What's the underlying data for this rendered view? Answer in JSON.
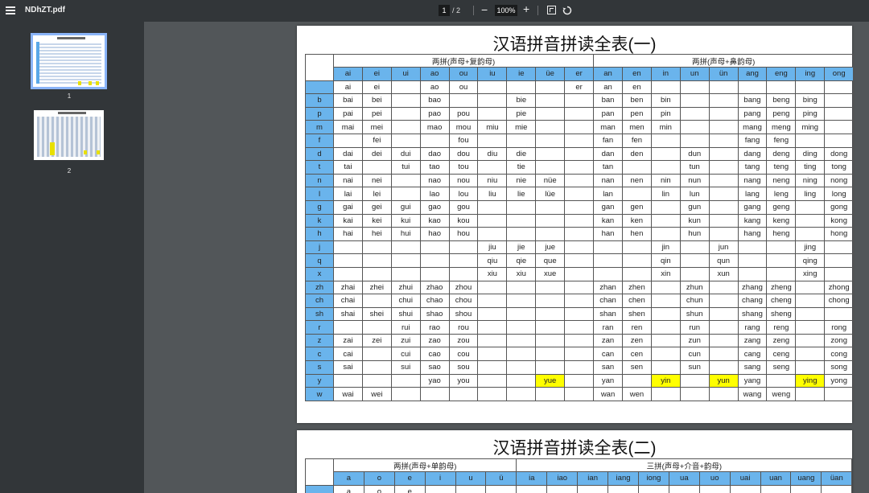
{
  "toolbar": {
    "title": "NDhZT.pdf",
    "page_current": "1",
    "page_sep": "/  2",
    "zoom_out": "−",
    "zoom_value": "100%",
    "zoom_in": "+",
    "icons": [
      "menu-icon",
      "fit-page-icon",
      "rotate-icon"
    ]
  },
  "sidebar": {
    "thumbs": [
      {
        "label": "1"
      },
      {
        "label": "2"
      }
    ]
  },
  "page1": {
    "title": "汉语拼音拼读全表(一)",
    "group_left": "两拼(声母+复韵母)",
    "group_right": "两拼(声母+鼻韵母)",
    "finals": [
      "ai",
      "ei",
      "ui",
      "ao",
      "ou",
      "iu",
      "ie",
      "üe",
      "er",
      "an",
      "en",
      "in",
      "un",
      "ün",
      "ang",
      "eng",
      "ing",
      "ong"
    ],
    "rows": [
      {
        "init": "",
        "cells": [
          "ai",
          "ei",
          "",
          "ao",
          "ou",
          "",
          "",
          "",
          "er",
          "an",
          "en",
          "",
          "",
          "",
          "",
          "",
          "",
          ""
        ]
      },
      {
        "init": "b",
        "cells": [
          "bai",
          "bei",
          "",
          "bao",
          "",
          "",
          "bie",
          "",
          "",
          "ban",
          "ben",
          "bin",
          "",
          "",
          "bang",
          "beng",
          "bing",
          ""
        ]
      },
      {
        "init": "p",
        "cells": [
          "pai",
          "pei",
          "",
          "pao",
          "pou",
          "",
          "pie",
          "",
          "",
          "pan",
          "pen",
          "pin",
          "",
          "",
          "pang",
          "peng",
          "ping",
          ""
        ]
      },
      {
        "init": "m",
        "cells": [
          "mai",
          "mei",
          "",
          "mao",
          "mou",
          "miu",
          "mie",
          "",
          "",
          "man",
          "men",
          "min",
          "",
          "",
          "mang",
          "meng",
          "ming",
          ""
        ]
      },
      {
        "init": "f",
        "cells": [
          "",
          "fei",
          "",
          "",
          "fou",
          "",
          "",
          "",
          "",
          "fan",
          "fen",
          "",
          "",
          "",
          "fang",
          "feng",
          "",
          ""
        ]
      },
      {
        "init": "d",
        "cells": [
          "dai",
          "dei",
          "dui",
          "dao",
          "dou",
          "diu",
          "die",
          "",
          "",
          "dan",
          "den",
          "",
          "dun",
          "",
          "dang",
          "deng",
          "ding",
          "dong"
        ]
      },
      {
        "init": "t",
        "cells": [
          "tai",
          "",
          "tui",
          "tao",
          "tou",
          "",
          "tie",
          "",
          "",
          "tan",
          "",
          "",
          "tun",
          "",
          "tang",
          "teng",
          "ting",
          "tong"
        ]
      },
      {
        "init": "n",
        "cells": [
          "nai",
          "nei",
          "",
          "nao",
          "nou",
          "niu",
          "nie",
          "nüe",
          "",
          "nan",
          "nen",
          "nin",
          "nun",
          "",
          "nang",
          "neng",
          "ning",
          "nong"
        ]
      },
      {
        "init": "l",
        "cells": [
          "lai",
          "lei",
          "",
          "lao",
          "lou",
          "liu",
          "lie",
          "lüe",
          "",
          "lan",
          "",
          "lin",
          "lun",
          "",
          "lang",
          "leng",
          "ling",
          "long"
        ]
      },
      {
        "init": "g",
        "cells": [
          "gai",
          "gei",
          "gui",
          "gao",
          "gou",
          "",
          "",
          "",
          "",
          "gan",
          "gen",
          "",
          "gun",
          "",
          "gang",
          "geng",
          "",
          "gong"
        ]
      },
      {
        "init": "k",
        "cells": [
          "kai",
          "kei",
          "kui",
          "kao",
          "kou",
          "",
          "",
          "",
          "",
          "kan",
          "ken",
          "",
          "kun",
          "",
          "kang",
          "keng",
          "",
          "kong"
        ]
      },
      {
        "init": "h",
        "cells": [
          "hai",
          "hei",
          "hui",
          "hao",
          "hou",
          "",
          "",
          "",
          "",
          "han",
          "hen",
          "",
          "hun",
          "",
          "hang",
          "heng",
          "",
          "hong"
        ]
      },
      {
        "init": "j",
        "cells": [
          "",
          "",
          "",
          "",
          "",
          "jiu",
          "jie",
          "jue",
          "",
          "",
          "",
          "jin",
          "",
          "jun",
          "",
          "",
          "jing",
          ""
        ]
      },
      {
        "init": "q",
        "cells": [
          "",
          "",
          "",
          "",
          "",
          "qiu",
          "qie",
          "que",
          "",
          "",
          "",
          "qin",
          "",
          "qun",
          "",
          "",
          "qing",
          ""
        ]
      },
      {
        "init": "x",
        "cells": [
          "",
          "",
          "",
          "",
          "",
          "xiu",
          "xiu",
          "xue",
          "",
          "",
          "",
          "xin",
          "",
          "xun",
          "",
          "",
          "xing",
          ""
        ]
      },
      {
        "init": "zh",
        "cells": [
          "zhai",
          "zhei",
          "zhui",
          "zhao",
          "zhou",
          "",
          "",
          "",
          "",
          "zhan",
          "zhen",
          "",
          "zhun",
          "",
          "zhang",
          "zheng",
          "",
          "zhong"
        ]
      },
      {
        "init": "ch",
        "cells": [
          "chai",
          "",
          "chui",
          "chao",
          "chou",
          "",
          "",
          "",
          "",
          "chan",
          "chen",
          "",
          "chun",
          "",
          "chang",
          "cheng",
          "",
          "chong"
        ]
      },
      {
        "init": "sh",
        "cells": [
          "shai",
          "shei",
          "shui",
          "shao",
          "shou",
          "",
          "",
          "",
          "",
          "shan",
          "shen",
          "",
          "shun",
          "",
          "shang",
          "sheng",
          "",
          ""
        ]
      },
      {
        "init": "r",
        "cells": [
          "",
          "",
          "rui",
          "rao",
          "rou",
          "",
          "",
          "",
          "",
          "ran",
          "ren",
          "",
          "run",
          "",
          "rang",
          "reng",
          "",
          "rong"
        ]
      },
      {
        "init": "z",
        "cells": [
          "zai",
          "zei",
          "zui",
          "zao",
          "zou",
          "",
          "",
          "",
          "",
          "zan",
          "zen",
          "",
          "zun",
          "",
          "zang",
          "zeng",
          "",
          "zong"
        ]
      },
      {
        "init": "c",
        "cells": [
          "cai",
          "",
          "cui",
          "cao",
          "cou",
          "",
          "",
          "",
          "",
          "can",
          "cen",
          "",
          "cun",
          "",
          "cang",
          "ceng",
          "",
          "cong"
        ]
      },
      {
        "init": "s",
        "cells": [
          "sai",
          "",
          "sui",
          "sao",
          "sou",
          "",
          "",
          "",
          "",
          "san",
          "sen",
          "",
          "sun",
          "",
          "sang",
          "seng",
          "",
          "song"
        ]
      },
      {
        "init": "y",
        "cells": [
          "",
          "",
          "",
          "yao",
          "you",
          "",
          "",
          "yue",
          "",
          "yan",
          "",
          "yin",
          "",
          "yun",
          "yang",
          "",
          "ying",
          "yong"
        ]
      },
      {
        "init": "w",
        "cells": [
          "wai",
          "wei",
          "",
          "",
          "",
          "",
          "",
          "",
          "",
          "wan",
          "wen",
          "",
          "",
          "",
          "wang",
          "weng",
          "",
          ""
        ]
      }
    ],
    "highlights": [
      [
        22,
        7
      ],
      [
        22,
        11
      ],
      [
        22,
        13
      ],
      [
        22,
        16
      ]
    ]
  },
  "page2": {
    "title": "汉语拼音拼读全表(二)",
    "group_left": "两拼(声母+单韵母)",
    "group_right": "三拼(声母+介音+韵母)",
    "finals": [
      "a",
      "o",
      "e",
      "i",
      "u",
      "ü",
      "ia",
      "iao",
      "ian",
      "iang",
      "iong",
      "ua",
      "uo",
      "uai",
      "uan",
      "uang",
      "üan"
    ],
    "partial_row": [
      "a",
      "o",
      "e",
      "",
      "",
      "",
      "",
      "",
      "",
      "",
      "",
      "",
      "",
      "",
      "",
      "",
      ""
    ]
  }
}
